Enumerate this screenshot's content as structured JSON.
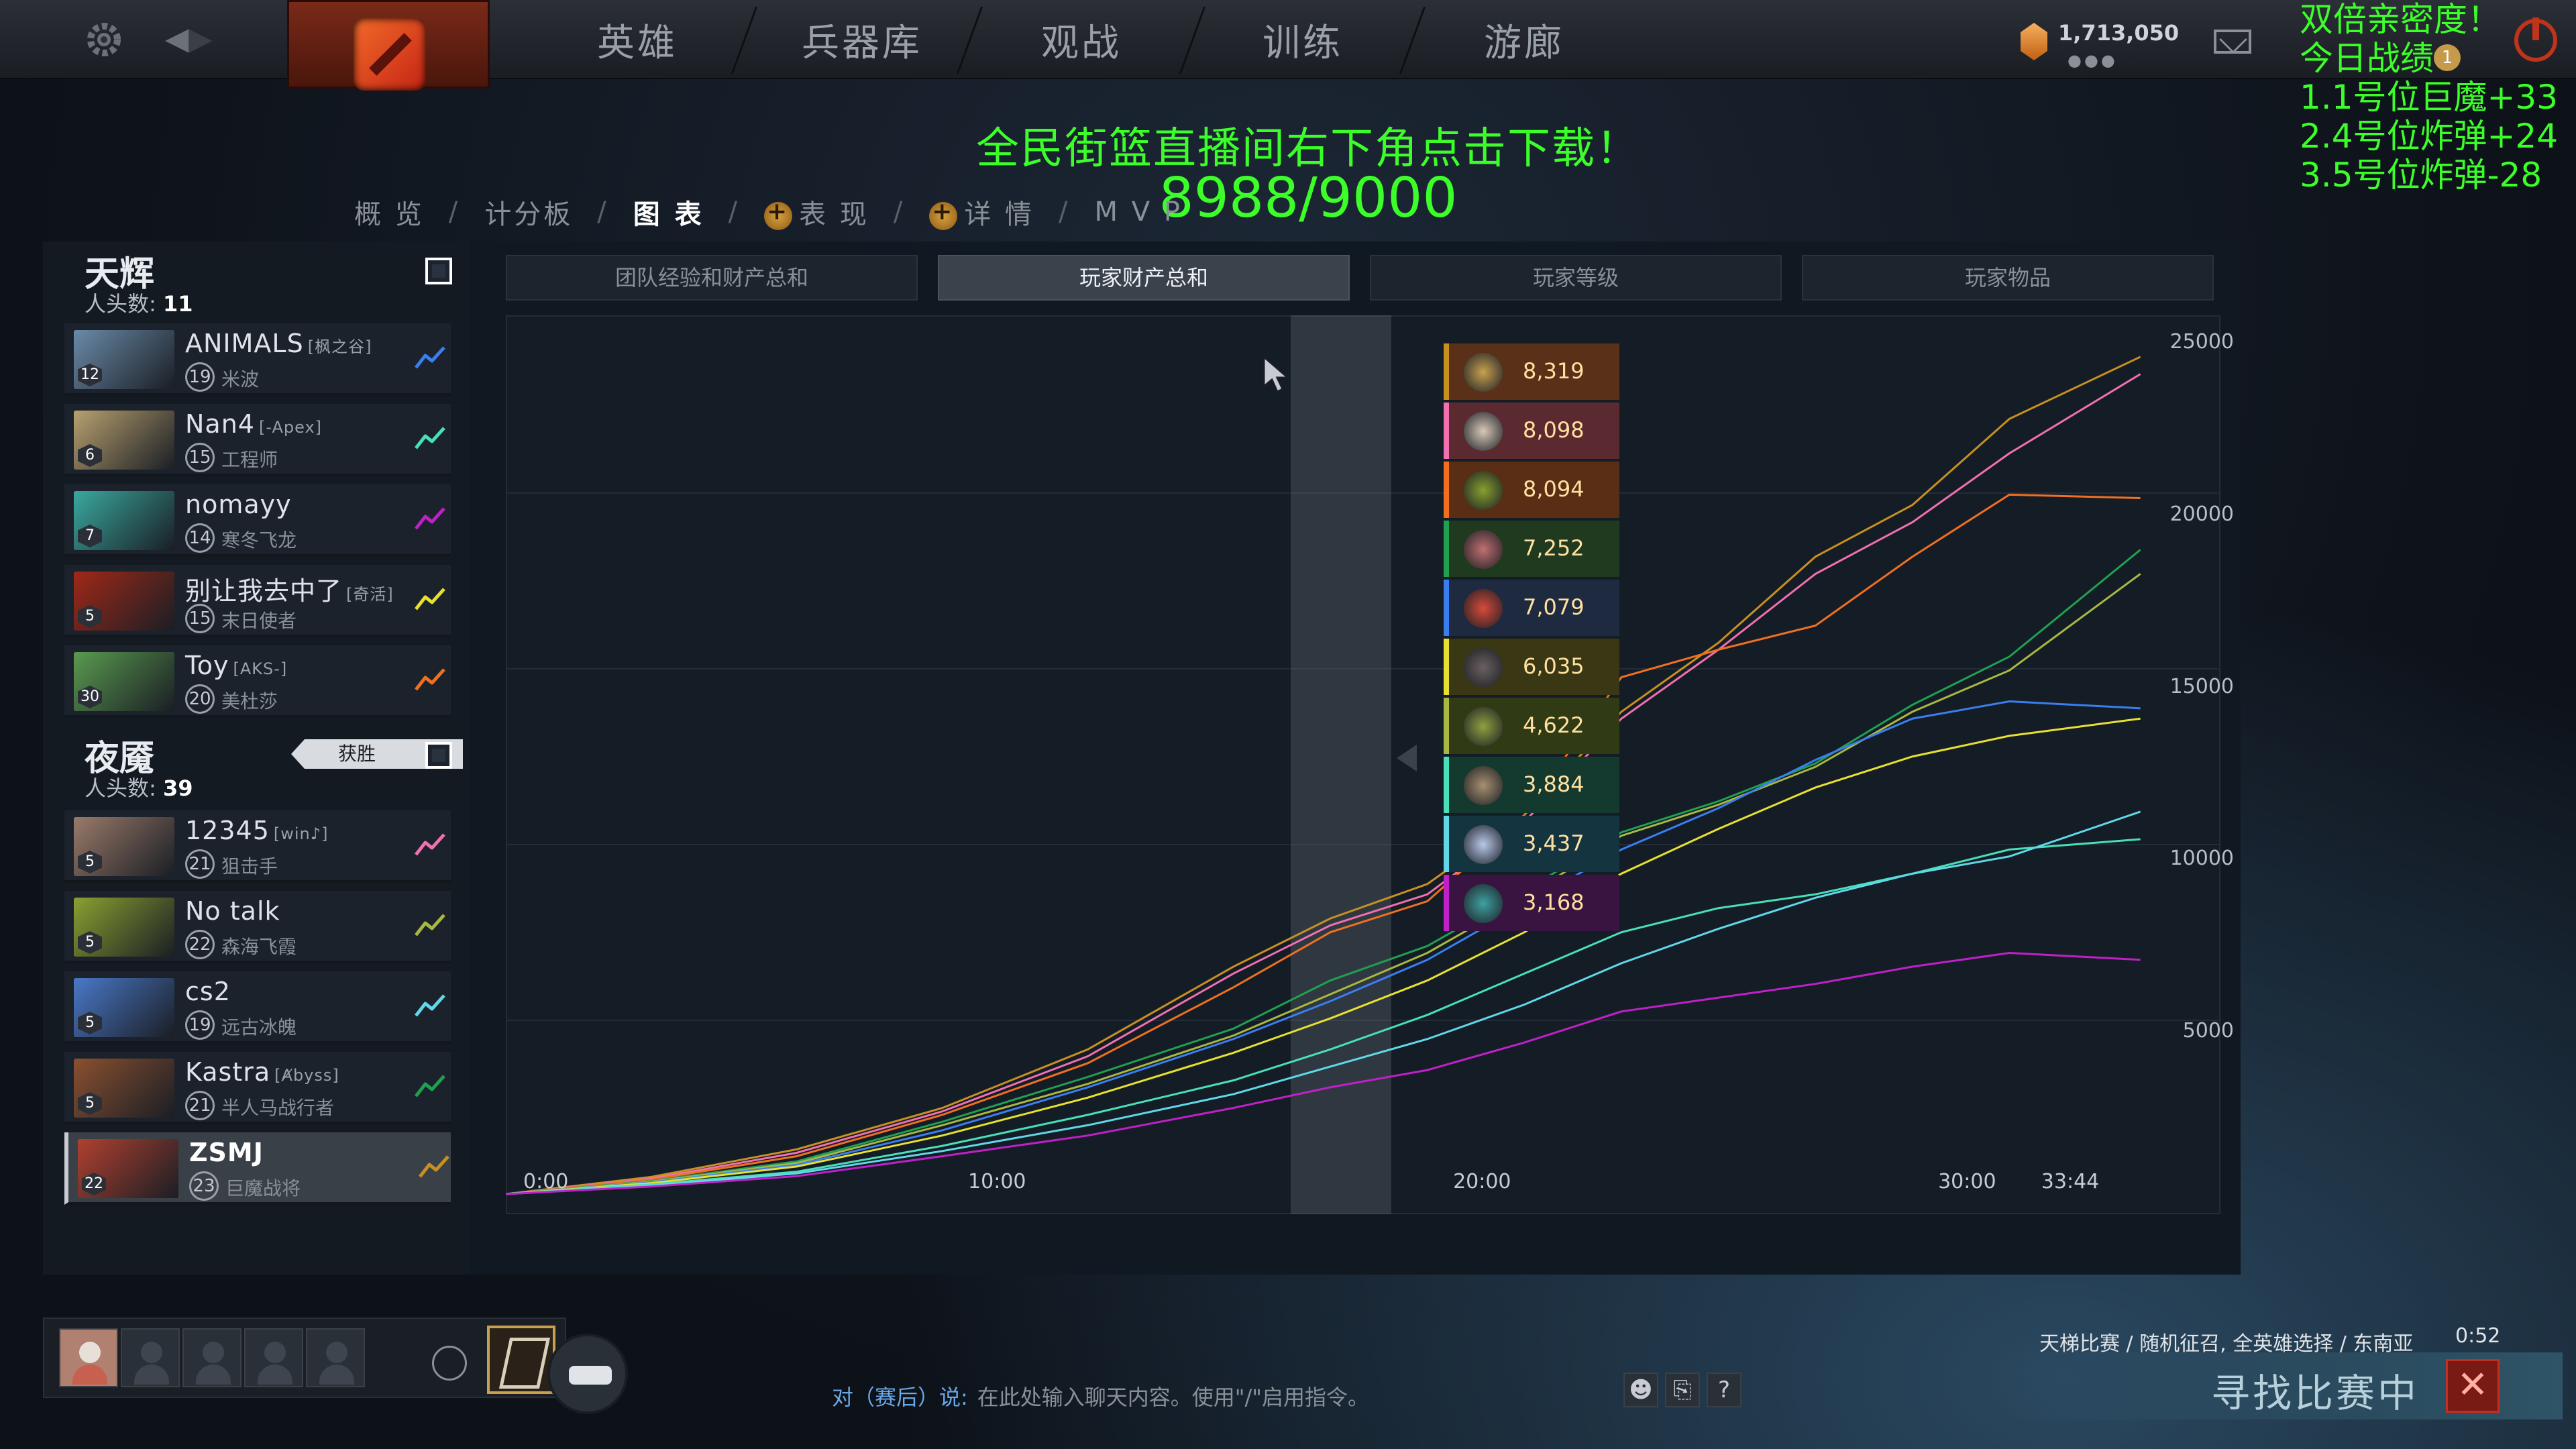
{
  "topbar": {
    "menu": [
      "英雄",
      "兵器库",
      "观战",
      "训练",
      "游廊"
    ],
    "gold": "1,713,050",
    "notification_count": "1"
  },
  "overlay": {
    "top_right_lines": [
      "双倍亲密度！",
      "今日战绩",
      "1.1号位巨魔+33",
      "2.4号位炸弹+24",
      "3.5号位炸弹-28"
    ],
    "banner": "全民街篮直播间右下角点击下载！",
    "counter": "8988/9000"
  },
  "subnav": {
    "items": [
      "概 览",
      "计分板",
      "图 表",
      "表 现",
      "详 情",
      "M V P"
    ],
    "active": "图 表"
  },
  "radiant": {
    "name": "天辉",
    "kills_label": "人头数:",
    "kills": "11",
    "players": [
      {
        "name": "ANIMALS",
        "tag": "[枫之谷]",
        "level": "19",
        "hero": "米波",
        "badge": "12",
        "color": "#3a7ef0",
        "portrait": "#6a8aa8"
      },
      {
        "name": "Nan4",
        "tag": "[-Apex]",
        "level": "15",
        "hero": "工程师",
        "badge": "6",
        "color": "#48e0b8",
        "portrait": "#b8a070"
      },
      {
        "name": "nomayy",
        "tag": "",
        "level": "14",
        "hero": "寒冬飞龙",
        "badge": "7",
        "color": "#c020c8",
        "portrait": "#3aa8a0"
      },
      {
        "name": "别让我去中了",
        "tag": "[奇活]",
        "level": "15",
        "hero": "末日使者",
        "badge": "5",
        "color": "#e8e030",
        "portrait": "#a02818"
      },
      {
        "name": "Toy",
        "tag": "[AKS-]",
        "level": "20",
        "hero": "美杜莎",
        "badge": "30",
        "color": "#f07020",
        "portrait": "#5a9a50"
      }
    ]
  },
  "dire": {
    "name": "夜魇",
    "kills_label": "人头数:",
    "kills": "39",
    "win_label": "获胜",
    "players": [
      {
        "name": "12345",
        "tag": "[win♪]",
        "level": "21",
        "hero": "狙击手",
        "badge": "5",
        "color": "#f070b0",
        "portrait": "#9a7a6a"
      },
      {
        "name": "No talk",
        "tag": "",
        "level": "22",
        "hero": "森海飞霞",
        "badge": "5",
        "color": "#a8b840",
        "portrait": "#8aa030"
      },
      {
        "name": "cs2",
        "tag": "",
        "level": "19",
        "hero": "远古冰魄",
        "badge": "5",
        "color": "#60d8e8",
        "portrait": "#4a78c8"
      },
      {
        "name": "Kastra",
        "tag": "[Ⱥbyss]",
        "level": "21",
        "hero": "半人马战行者",
        "badge": "5",
        "color": "#20a050",
        "portrait": "#8a5030"
      },
      {
        "name": "ZSMJ",
        "tag": "",
        "level": "23",
        "hero": "巨魔战将",
        "badge": "22",
        "color": "#c89020",
        "portrait": "#b04030"
      }
    ]
  },
  "chart_tabs": [
    "团队经验和财产总和",
    "玩家财产总和",
    "玩家等级",
    "玩家物品"
  ],
  "chart_tabs_active": 1,
  "chart_data": {
    "type": "line",
    "x_ticks": [
      "0:00",
      "10:00",
      "20:00",
      "30:00",
      "33:44"
    ],
    "y_ticks": [
      "5000",
      "10000",
      "15000",
      "20000",
      "25000"
    ],
    "ylim": [
      0,
      25000
    ],
    "x_minutes": [
      0,
      3,
      6,
      9,
      12,
      15,
      17,
      19,
      21,
      23,
      25,
      27,
      29,
      31,
      33.7
    ],
    "series": [
      {
        "color": "#c89020",
        "values": [
          0,
          500,
          1300,
          2500,
          4200,
          6600,
          8000,
          9000,
          11000,
          14000,
          16000,
          18500,
          20000,
          22500,
          24300
        ]
      },
      {
        "color": "#f070b0",
        "values": [
          0,
          450,
          1200,
          2400,
          4000,
          6400,
          7800,
          8700,
          10800,
          13800,
          15800,
          18000,
          19500,
          21500,
          23800
        ]
      },
      {
        "color": "#f07020",
        "values": [
          0,
          420,
          1100,
          2300,
          3800,
          6000,
          7600,
          8500,
          11000,
          15000,
          15800,
          16500,
          18500,
          20300,
          20200
        ]
      },
      {
        "color": "#20a050",
        "values": [
          0,
          380,
          950,
          2100,
          3400,
          4800,
          6200,
          7200,
          8800,
          10500,
          11400,
          12500,
          14200,
          15600,
          18700
        ]
      },
      {
        "color": "#a8b840",
        "values": [
          0,
          360,
          900,
          2000,
          3200,
          4600,
          5800,
          7000,
          8600,
          10400,
          11300,
          12400,
          14000,
          15200,
          18000
        ]
      },
      {
        "color": "#3a7ef0",
        "values": [
          0,
          340,
          850,
          1850,
          3100,
          4500,
          5600,
          6800,
          8400,
          10000,
          11200,
          12600,
          13800,
          14300,
          14100
        ]
      },
      {
        "color": "#e8e030",
        "values": [
          0,
          320,
          800,
          1700,
          2800,
          4100,
          5100,
          6200,
          7600,
          9300,
          10600,
          11800,
          12700,
          13300,
          13800
        ]
      },
      {
        "color": "#48e0b8",
        "values": [
          0,
          280,
          650,
          1400,
          2300,
          3300,
          4200,
          5200,
          6400,
          7600,
          8300,
          8700,
          9300,
          10000,
          10300
        ]
      },
      {
        "color": "#60d8e8",
        "values": [
          0,
          250,
          600,
          1250,
          2000,
          2900,
          3700,
          4500,
          5500,
          6700,
          7700,
          8600,
          9300,
          9800,
          11100
        ]
      },
      {
        "color": "#c020c8",
        "values": [
          0,
          220,
          520,
          1100,
          1700,
          2500,
          3100,
          3600,
          4400,
          5300,
          5700,
          6100,
          6600,
          7000,
          6800
        ]
      }
    ]
  },
  "tooltip": [
    {
      "value": "8,319",
      "border": "#c89020",
      "bg": "#5a3018",
      "icon": "#c8a050"
    },
    {
      "value": "8,098",
      "border": "#f070b0",
      "bg": "#5a2a30",
      "icon": "#d8c8b8"
    },
    {
      "value": "8,094",
      "border": "#f07020",
      "bg": "#5a2e14",
      "icon": "#88a030"
    },
    {
      "value": "7,252",
      "border": "#20a050",
      "bg": "#203a20",
      "icon": "#c07070"
    },
    {
      "value": "7,079",
      "border": "#3a7ef0",
      "bg": "#1e2a40",
      "icon": "#d84a3a"
    },
    {
      "value": "6,035",
      "border": "#e8e030",
      "bg": "#3a3814",
      "icon": "#6a6060"
    },
    {
      "value": "4,622",
      "border": "#a8b840",
      "bg": "#303a14",
      "icon": "#90a040"
    },
    {
      "value": "3,884",
      "border": "#48e0b8",
      "bg": "#143a30",
      "icon": "#a89070"
    },
    {
      "value": "3,437",
      "border": "#60d8e8",
      "bg": "#143440",
      "icon": "#b8c8e8"
    },
    {
      "value": "3,168",
      "border": "#c020c8",
      "bg": "#3a1440",
      "icon": "#40a0a0"
    }
  ],
  "bottom": {
    "chat_prefix": "对（赛后）说:",
    "chat_placeholder": "在此处输入聊天内容。使用\"/\"启用指令。",
    "help_icon": "?",
    "match_info": "天梯比赛 / 随机征召, 全英雄选择 / 东南亚",
    "match_time": "0:52",
    "finding": "寻找比赛中",
    "cancel": "✕"
  }
}
